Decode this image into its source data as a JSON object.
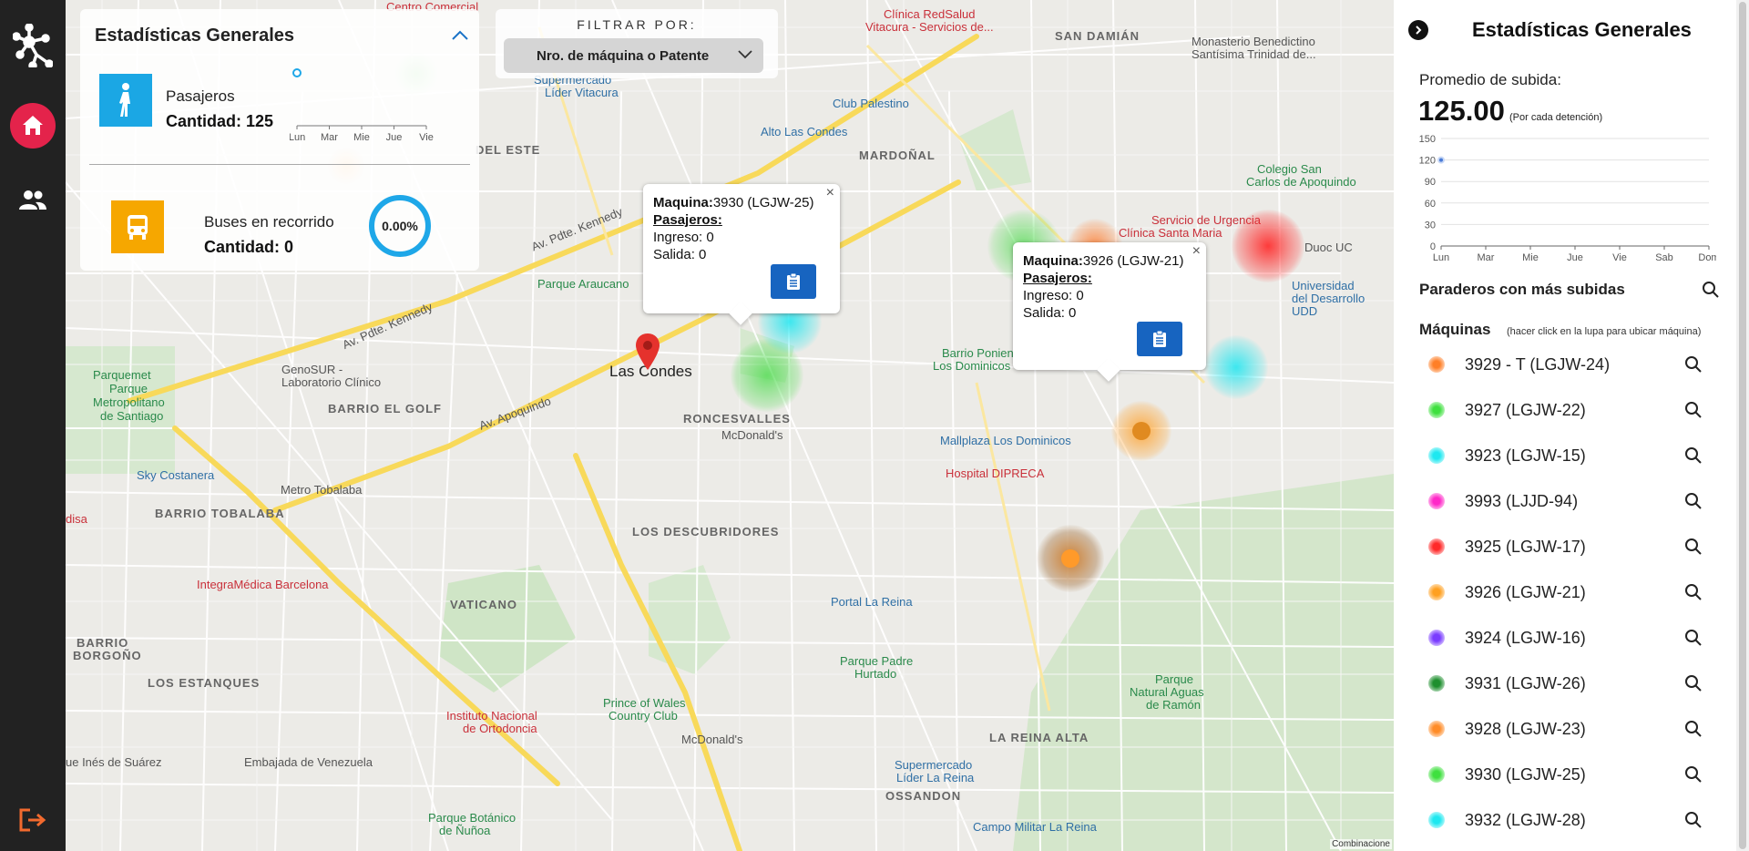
{
  "nav": {
    "items": [
      {
        "name": "logo",
        "icon": "network-logo-icon"
      },
      {
        "name": "home",
        "icon": "home-icon",
        "active": true
      },
      {
        "name": "users",
        "icon": "users-icon"
      },
      {
        "name": "logout",
        "icon": "logout-icon"
      }
    ],
    "accent": "#e4234b"
  },
  "map": {
    "labels": {
      "centro_comercial": "Centro Comercial",
      "clinica_redsalud": "Clínica RedSalud",
      "vitacura_servicios": "Vitacura - Servicios de...",
      "san_damian": "SAN DAMIÁN",
      "monasterio": "Monasterio Benedictino",
      "santisima": "Santísima Trinidad de...",
      "supermercado_lider": "Supermercado",
      "lider_vitacura": "Líder Vitacura",
      "club_palestino": "Club Palestino",
      "alto_las_condes": "Alto Las Condes",
      "del_este": "DEL ESTE",
      "mardonal": "MARDOÑAL",
      "colegio_san": "Colegio San",
      "carlos_apoquindo": "Carlos de Apoquindo",
      "servicio_urgencia": "Servicio de Urgencia",
      "clinica_santa": "Clínica Santa Maria",
      "duoc": "Duoc UC",
      "universidad": "Universidad",
      "del_desarrollo": "del Desarrollo",
      "udd": "UDD",
      "parque_araucano": "Parque Araucano",
      "las_condes": "Las Condes",
      "barrio_poniente": "Barrio Poniente",
      "los_dominicos": "Los Dominicos",
      "parquemet": "Parquemet",
      "parque_metropolitano": "Parque",
      "metropolitano": "Metropolitano",
      "de_santiago": "de Santiago",
      "genosur": "GenoSUR -",
      "laboratorio": "Laboratorio Clínico",
      "barrio_el_golf": "BARRIO EL GOLF",
      "roncesvalles": "RONCESVALLES",
      "mcdonalds_1": "McDonald's",
      "mallplaza": "Mallplaza Los Dominicos",
      "hospital_dipreca": "Hospital DIPRECA",
      "sky_costanera": "Sky Costanera",
      "metro_tobalaba": "Metro Tobalaba",
      "barrio_tobalaba": "BARRIO TOBALABA",
      "disa": "disa",
      "integramedica": "IntegraMédica Barcelona",
      "los_descubridores": "LOS DESCUBRIDORES",
      "vaticano": "VATICANO",
      "barrio_borgono": "BARRIO",
      "borgono": "BORGOÑO",
      "portal_la_reina": "Portal La Reina",
      "parque_padre": "Parque Padre",
      "hurtado": "Hurtado",
      "los_estanques": "LOS ESTANQUES",
      "prince_wales": "Prince of Wales",
      "country_club": "Country Club",
      "instituto_nacional": "Instituto Nacional",
      "de_ortodoncia": "de Ortodoncia",
      "mcdonalds_2": "McDonald's",
      "parque_natural": "Parque",
      "natural_aguas": "Natural Aguas",
      "de_ramon": "de Ramón",
      "ines_suarez": "ue Inés de Suárez",
      "embajada": "Embajada de Venezuela",
      "la_reina_alta": "LA REINA ALTA",
      "supermercado_lider_2": "Supermercado",
      "lider_la_reina": "Líder La Reina",
      "ossandon": "OSSANDON",
      "campo_militar": "Campo Militar La Reina",
      "parque_botanico": "Parque Botánico",
      "de_nunoa": "de Ñuñoa",
      "av_kennedy": "Av. Pdte. Kennedy",
      "av_apoquindo": "Av. Apoquindo",
      "av_kennedy_2": "Av. Pdte. Kennedy",
      "attribution": "Combinacione"
    }
  },
  "stats_overlay": {
    "title": "Estadísticas Generales",
    "pasajeros_label": "Pasajeros",
    "pasajeros_count": "Cantidad: 125",
    "mini_chart_days": [
      "Lun",
      "Mar",
      "Mie",
      "Jue",
      "Vie"
    ],
    "buses_label": "Buses en recorrido",
    "buses_count": "Cantidad: 0",
    "buses_percent": "0.00%",
    "buses_fraction": 0.0
  },
  "filter": {
    "label": "FILTRAR POR:",
    "selected": "Nro. de máquina o Patente"
  },
  "popups": [
    {
      "maquina_label": "Maquina:",
      "maquina_value": "3930 (LGJW-25)",
      "pasajeros_label": "Pasajeros:",
      "ingreso": "Ingreso: 0",
      "salida": "Salida: 0",
      "close": "×"
    },
    {
      "maquina_label": "Maquina:",
      "maquina_value": "3926 (LGJW-21)",
      "pasajeros_label": "Pasajeros:",
      "ingreso": "Ingreso: 0",
      "salida": "Salida: 0",
      "close": "×"
    }
  ],
  "panel": {
    "title": "Estadísticas Generales",
    "avg_label": "Promedio de subida:",
    "avg_value": "125.00",
    "avg_note": "(Por cada detención)",
    "paraderos_label": "Paraderos con más subidas",
    "maquinas_label": "Máquinas",
    "maquinas_note": "(hacer click en la lupa para ubicar máquina)",
    "machines": [
      {
        "name": "3929 - T (LGJW-24)",
        "color": "#ff7f27"
      },
      {
        "name": "3927 (LGJW-22)",
        "color": "#3fe03f"
      },
      {
        "name": "3923 (LGJW-15)",
        "color": "#1ee8f0"
      },
      {
        "name": "3993 (LJJD-94)",
        "color": "#ff28c8"
      },
      {
        "name": "3925 (LGJW-17)",
        "color": "#ff2a2a"
      },
      {
        "name": "3926 (LGJW-21)",
        "color": "#ffa020"
      },
      {
        "name": "3924 (LGJW-16)",
        "color": "#7a3cff"
      },
      {
        "name": "3931 (LGJW-26)",
        "color": "#1e8f2e"
      },
      {
        "name": "3928 (LGJW-23)",
        "color": "#ff8c28"
      },
      {
        "name": "3930 (LGJW-25)",
        "color": "#3fe03f"
      },
      {
        "name": "3932 (LGJW-28)",
        "color": "#1ee8f0"
      }
    ]
  },
  "chart_data": [
    {
      "type": "line",
      "categories": [
        "Lun",
        "Mar",
        "Mie",
        "Jue",
        "Vie",
        "Sab",
        "Dom"
      ],
      "series": [
        {
          "values": [
            120,
            null,
            null,
            null,
            null,
            null,
            null
          ]
        }
      ],
      "yticks": [
        0,
        30,
        60,
        90,
        120,
        150
      ],
      "ylim": [
        0,
        150
      ],
      "grid": true
    }
  ]
}
